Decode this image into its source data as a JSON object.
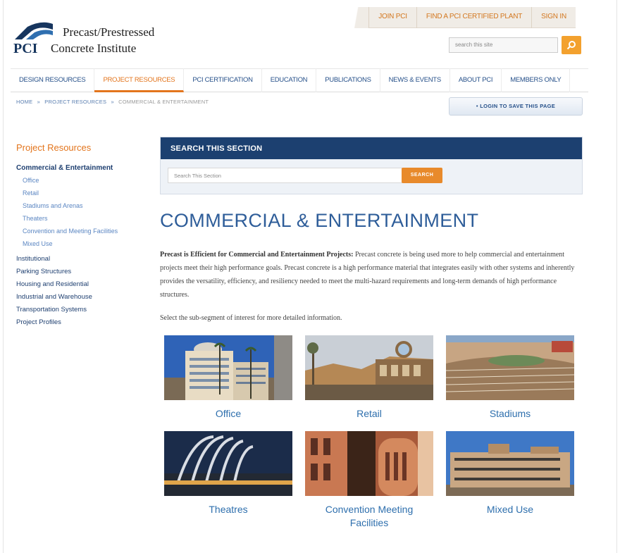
{
  "util_nav": [
    "JOIN PCI",
    "FIND A PCI CERTIFIED PLANT",
    "SIGN IN"
  ],
  "logo": {
    "line1": "Precast/Prestressed",
    "pci": "PCI",
    "line2": "Concrete Institute"
  },
  "top_search": {
    "placeholder": "search this site"
  },
  "nav": [
    "DESIGN RESOURCES",
    "PROJECT RESOURCES",
    "PCI CERTIFICATION",
    "EDUCATION",
    "PUBLICATIONS",
    "NEWS & EVENTS",
    "ABOUT PCI",
    "MEMBERS ONLY"
  ],
  "breadcrumb": [
    "HOME",
    "»",
    "PROJECT RESOURCES",
    "»",
    "COMMERCIAL & ENTERTAINMENT"
  ],
  "login_button": "LOGIN TO SAVE THIS PAGE",
  "sidebar": {
    "title": "Project Resources",
    "active": "Commercial & Entertainment",
    "subitems": [
      "Office",
      "Retail",
      "Stadiums and Arenas",
      "Theaters",
      "Convention and Meeting Facilities",
      "Mixed Use"
    ],
    "items": [
      "Institutional",
      "Parking Structures",
      "Housing and Residential",
      "Industrial and Warehouse",
      "Transportation Systems",
      "Project Profiles"
    ]
  },
  "section_search": {
    "heading": "SEARCH THIS SECTION",
    "placeholder": "Search This Section",
    "button": "SEARCH"
  },
  "page_title": "COMMERCIAL & ENTERTAINMENT",
  "intro": {
    "bold": "Precast is Efficient for Commercial and Entertainment Projects:",
    "text": " Precast concrete is being used more to help commercial and entertainment projects meet their high performance goals. Precast concrete is a high performance material that integrates easily with other systems and inherently provides the versatility, efficiency, and resiliency needed to meet the multi-hazard requirements and long-term demands of high performance structures."
  },
  "select_text": "Select the sub-segment of interest for more detailed information.",
  "tiles": [
    "Office",
    "Retail",
    "Stadiums",
    "Theatres",
    "Convention Meeting Facilities",
    "Mixed Use"
  ],
  "colors": {
    "brand_navy": "#1c4070",
    "accent_orange": "#e3751d",
    "link_blue": "#2e6fad"
  }
}
